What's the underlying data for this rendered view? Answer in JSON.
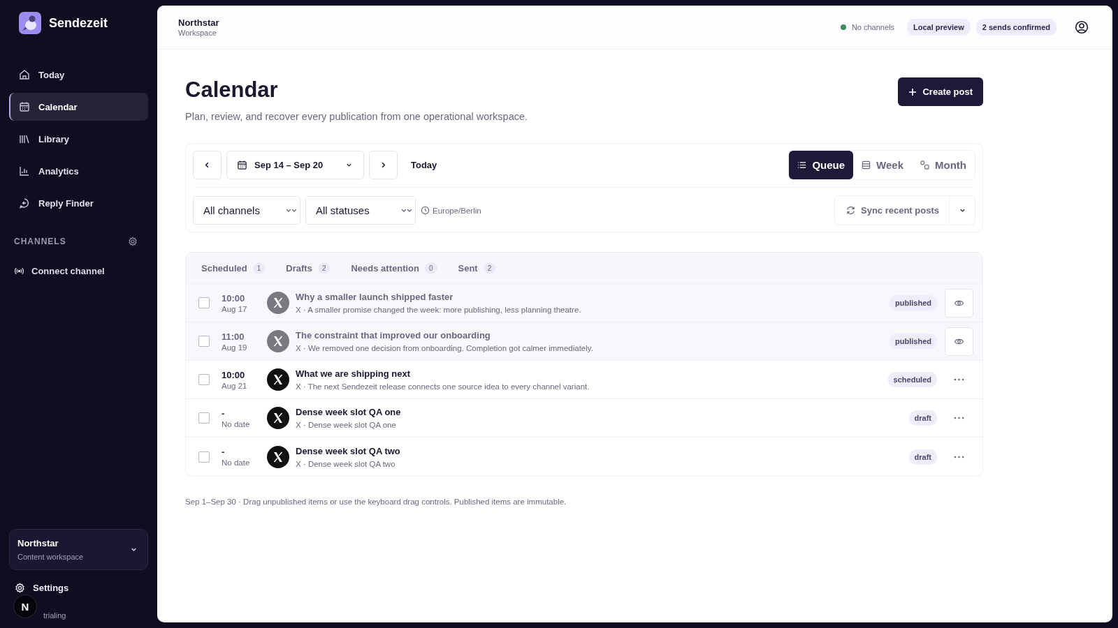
{
  "brand": {
    "name": "Sendezeit"
  },
  "nav": [
    {
      "label": "Today",
      "selected": false
    },
    {
      "label": "Calendar",
      "selected": true
    },
    {
      "label": "Library",
      "selected": false
    },
    {
      "label": "Analytics",
      "selected": false
    },
    {
      "label": "Reply Finder",
      "selected": false
    }
  ],
  "channels": {
    "heading": "CHANNELS",
    "connect": "Connect channel"
  },
  "workspace_card": {
    "name": "Northstar",
    "subtitle": "Content workspace"
  },
  "settings": "Settings",
  "avatar": "N",
  "plan": "trialing",
  "header": {
    "title": "Northstar",
    "subtitle": "Workspace",
    "status": "No channels",
    "badges": [
      "Local preview",
      "2 sends confirmed"
    ]
  },
  "page": {
    "title": "Calendar",
    "subtitle": "Plan, review, and recover every publication from one operational workspace.",
    "create": "Create post"
  },
  "range": "Sep 14 – Sep 20",
  "today": "Today",
  "views": [
    {
      "label": "Queue",
      "selected": true
    },
    {
      "label": "Week",
      "selected": false
    },
    {
      "label": "Month",
      "selected": false
    }
  ],
  "filters": [
    {
      "value": "All channels"
    },
    {
      "value": "All statuses"
    }
  ],
  "timezone": "Europe/Berlin",
  "sync": "Sync recent posts",
  "tabs": [
    {
      "label": "Scheduled",
      "count": "1",
      "selected": false
    },
    {
      "label": "Drafts",
      "count": "2",
      "selected": false
    },
    {
      "label": "Needs attention",
      "count": "0",
      "selected": false
    },
    {
      "label": "Sent",
      "count": "2",
      "selected": false
    }
  ],
  "rows": [
    {
      "time": "10:00",
      "date": "Aug 17",
      "title": "Why a smaller launch shipped faster",
      "preview": "X · A smaller promise changed the week: more publishing, less planning theatre.",
      "status": "published",
      "dimmed": true,
      "kind": "view",
      "checked": false
    },
    {
      "time": "11:00",
      "date": "Aug 19",
      "title": "The constraint that improved our onboarding",
      "preview": "X · We removed one decision from onboarding. Completion got calmer immediately.",
      "status": "published",
      "dimmed": true,
      "kind": "view",
      "checked": false
    },
    {
      "time": "10:00",
      "date": "Aug 21",
      "title": "What we are shipping next",
      "preview": "X · The next Sendezeit release connects one source idea to every channel variant.",
      "status": "scheduled",
      "dimmed": false,
      "kind": "more",
      "checked": false
    },
    {
      "time": "-",
      "date": "No date",
      "title": "Dense week slot QA one",
      "preview": "X · Dense week slot QA one",
      "status": "draft",
      "dimmed": false,
      "kind": "more",
      "checked": false
    },
    {
      "time": "-",
      "date": "No date",
      "title": "Dense week slot QA two",
      "preview": "X · Dense week slot QA two",
      "status": "draft",
      "dimmed": false,
      "kind": "more",
      "checked": false
    }
  ],
  "footer": "Sep 1–Sep 30 · Drag unpublished items or use the keyboard drag controls. Published items are immutable."
}
